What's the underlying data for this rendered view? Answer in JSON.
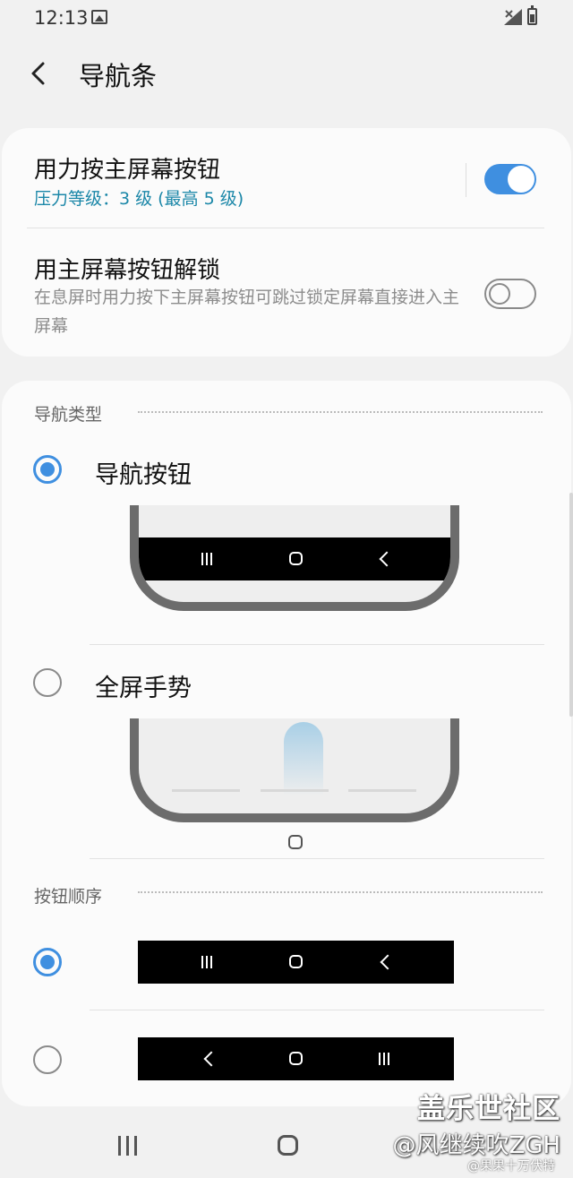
{
  "status_bar": {
    "time": "12:13"
  },
  "header": {
    "title": "导航条"
  },
  "settings": {
    "force_press": {
      "title": "用力按主屏幕按钮",
      "subtitle": "压力等级：3 级 (最高 5 级)",
      "enabled": true
    },
    "unlock": {
      "title": "用主屏幕按钮解锁",
      "description": "在息屏时用力按下主屏幕按钮可跳过锁定屏幕直接进入主屏幕",
      "enabled": false
    }
  },
  "navigation_type": {
    "header": "导航类型",
    "options": [
      {
        "label": "导航按钮",
        "selected": true
      },
      {
        "label": "全屏手势",
        "selected": false
      }
    ]
  },
  "button_order": {
    "header": "按钮顺序",
    "options": [
      {
        "order": [
          "recents",
          "home",
          "back"
        ],
        "selected": true
      },
      {
        "order": [
          "back",
          "home",
          "recents"
        ],
        "selected": false
      }
    ]
  },
  "watermark": {
    "line1": "盖乐世社区",
    "line2": "@风继续吹ZGH",
    "line3": "@果果十万伏特"
  },
  "colors": {
    "accent": "#3f8fe0",
    "subtitle": "#1b87a8",
    "background": "#f1f1f1",
    "card": "#fbfbfb"
  }
}
